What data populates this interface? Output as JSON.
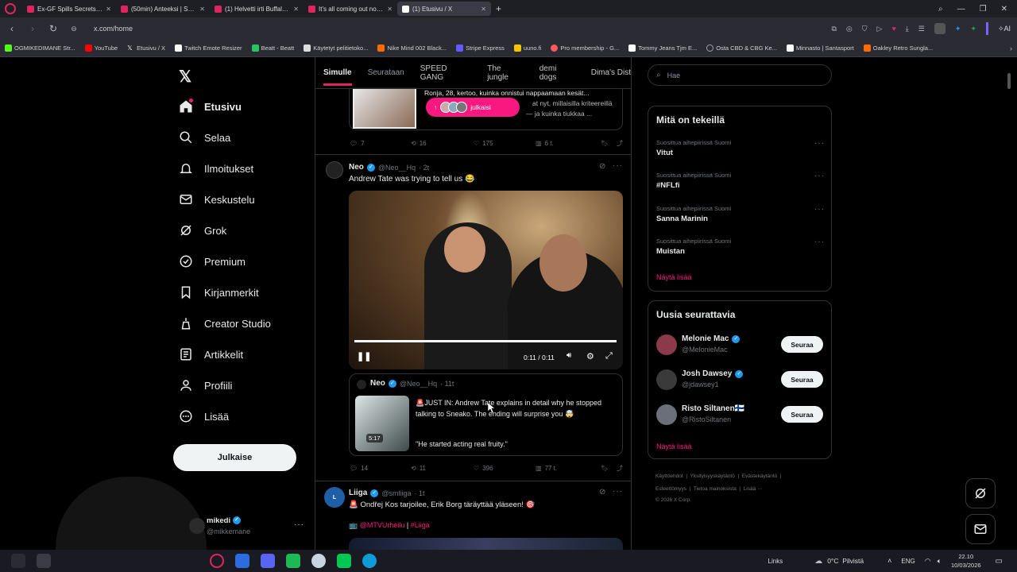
{
  "browser": {
    "tabs": [
      {
        "title": "Ex-GF Spills Secrets About...",
        "color": "#e0245e"
      },
      {
        "title": "(50min) Anteeksi | Suome...",
        "color": "#e0245e"
      },
      {
        "title": "(1) Helvetti irti Buffalossa!",
        "color": "#e0245e"
      },
      {
        "title": "It's all coming out now...",
        "color": "#e0245e"
      },
      {
        "title": "(1) Etusivu / X",
        "color": "#ffffff",
        "active": true
      }
    ],
    "url": "x.com/home",
    "bookmarks": [
      {
        "label": "OGMIKEDIMANE Str...",
        "color": "#53fc18"
      },
      {
        "label": "YouTube",
        "color": "#ff0000"
      },
      {
        "label": "Etusivu / X",
        "color": "#ffffff"
      },
      {
        "label": "Twitch Emote Resizer",
        "color": "#ffffff"
      },
      {
        "label": "Beatt - Beatt",
        "color": "#22c55e"
      },
      {
        "label": "Käytetyt pelitietoko...",
        "color": "#ffffff"
      },
      {
        "label": "Nike Mind 002 Black...",
        "color": "#ff6a00"
      },
      {
        "label": "Stripe Express",
        "color": "#635bff"
      },
      {
        "label": "uuno.fi",
        "color": "#f5c400"
      },
      {
        "label": "Pro membership - G...",
        "color": "#ff5a5f"
      },
      {
        "label": "Tommy Jeans Tjm E...",
        "color": "#ffffff"
      },
      {
        "label": "Osta CBD & CBG Ke...",
        "color": "#9aa0a6"
      },
      {
        "label": "Minnasto | Santasport",
        "color": "#ffffff"
      },
      {
        "label": "Oakley Retro Sungla...",
        "color": "#ff6a00"
      }
    ],
    "ai_label": "AI"
  },
  "sidebar": {
    "items": [
      {
        "label": "Etusivu",
        "icon": "home-icon"
      },
      {
        "label": "Selaa",
        "icon": "search-icon"
      },
      {
        "label": "Ilmoitukset",
        "icon": "bell-icon"
      },
      {
        "label": "Keskustelu",
        "icon": "mail-icon"
      },
      {
        "label": "Grok",
        "icon": "grok-icon"
      },
      {
        "label": "Premium",
        "icon": "premium-icon"
      },
      {
        "label": "Kirjanmerkit",
        "icon": "bookmark-icon"
      },
      {
        "label": "Creator Studio",
        "icon": "creator-icon"
      },
      {
        "label": "Artikkelit",
        "icon": "article-icon"
      },
      {
        "label": "Profiili",
        "icon": "profile-icon"
      },
      {
        "label": "Lisää",
        "icon": "more-icon"
      }
    ],
    "post_button": "Julkaise",
    "account": {
      "name": "mikedi",
      "handle": "@mikkemane"
    }
  },
  "feed": {
    "tabs": [
      "Simulle",
      "Seurataan",
      "SPEED GANG",
      "The jungle",
      "demi dogs",
      "Dima's Dist"
    ],
    "pill_label": "julkaisi",
    "prev_tweet": {
      "quote_line1": "Ronja, 28, kertoo, kuinka onnistui nappaamaan kesät...",
      "quote_line2": "at nyt, millaisilla kriteereillä",
      "quote_line3": "— ja kuinka tiukkaa ...",
      "replies": "7",
      "retweets": "16",
      "likes": "175",
      "views": "6 t."
    },
    "tweet1": {
      "name": "Neo",
      "handle": "@Neo__Hq",
      "time": "· 2t",
      "text": "Andrew Tate was trying to tell us 😂",
      "video_time": "0:11 / 0:11",
      "video_progress": 1.0,
      "quote": {
        "name": "Neo",
        "handle": "@Neo__Hq",
        "time": "· 11t",
        "text": "🚨JUST IN: Andrew Tate explains in detail why he stopped talking to Sneako. The ending will surprise you 🤯",
        "text2": "\"He started acting real fruity.\"",
        "duration": "5:17"
      },
      "replies": "14",
      "retweets": "11",
      "likes": "396",
      "views": "77 t."
    },
    "tweet2": {
      "name": "Liiga",
      "handle": "@smliiga",
      "time": "· 1t",
      "text": "🚨 Ondřej Kos tarjoilee, Erik Borg täräyttää yläseen! 🎯",
      "tags_prefix": "📺",
      "tag1": "@MTVUrheilu",
      "tag_sep": "|",
      "tag2": "#Liiga"
    }
  },
  "right": {
    "search_placeholder": "Hae",
    "trends_title": "Mitä on tekeillä",
    "trends": [
      {
        "context": "Suosittua aihepiirissä Suomi",
        "title": "Vitut"
      },
      {
        "context": "Suosittua aihepiirissä Suomi",
        "title": "#NFLfi"
      },
      {
        "context": "Suosittua aihepiirissä Suomi",
        "title": "Sanna Marinin"
      },
      {
        "context": "Suosittua aihepiirissä Suomi",
        "title": "Muistan"
      }
    ],
    "show_more": "Näytä lisää",
    "follow_title": "Uusia seurattavia",
    "follow": [
      {
        "name": "Melonie Mac",
        "handle": "@MelonieMac",
        "button": "Seuraa",
        "verified": true
      },
      {
        "name": "Josh Dawsey",
        "handle": "@jdawsey1",
        "button": "Seuraa",
        "verified": true
      },
      {
        "name": "Risto Siltanen🇫🇮",
        "handle": "@RistoSiltanen",
        "button": "Seuraa",
        "verified": false
      }
    ],
    "show_more2": "Näytä lisää",
    "footer": {
      "l1": "Käyttöehdot",
      "l2": "Yksityisyyskäytäntö",
      "l3": "Evästekäytäntö",
      "l4": "Esteettömyys",
      "l5": "Tietoa mainoksista",
      "l6": "Lisää ···",
      "l7": "© 2026 X Corp."
    }
  },
  "taskbar": {
    "links": "Links",
    "weather": "0°C  Pilvistä",
    "lang": "ENG",
    "time": "22.10",
    "date": "10/03/2026"
  },
  "colors": {
    "accent": "#f91880",
    "verified": "#1d9bf0",
    "bg": "#000000"
  }
}
